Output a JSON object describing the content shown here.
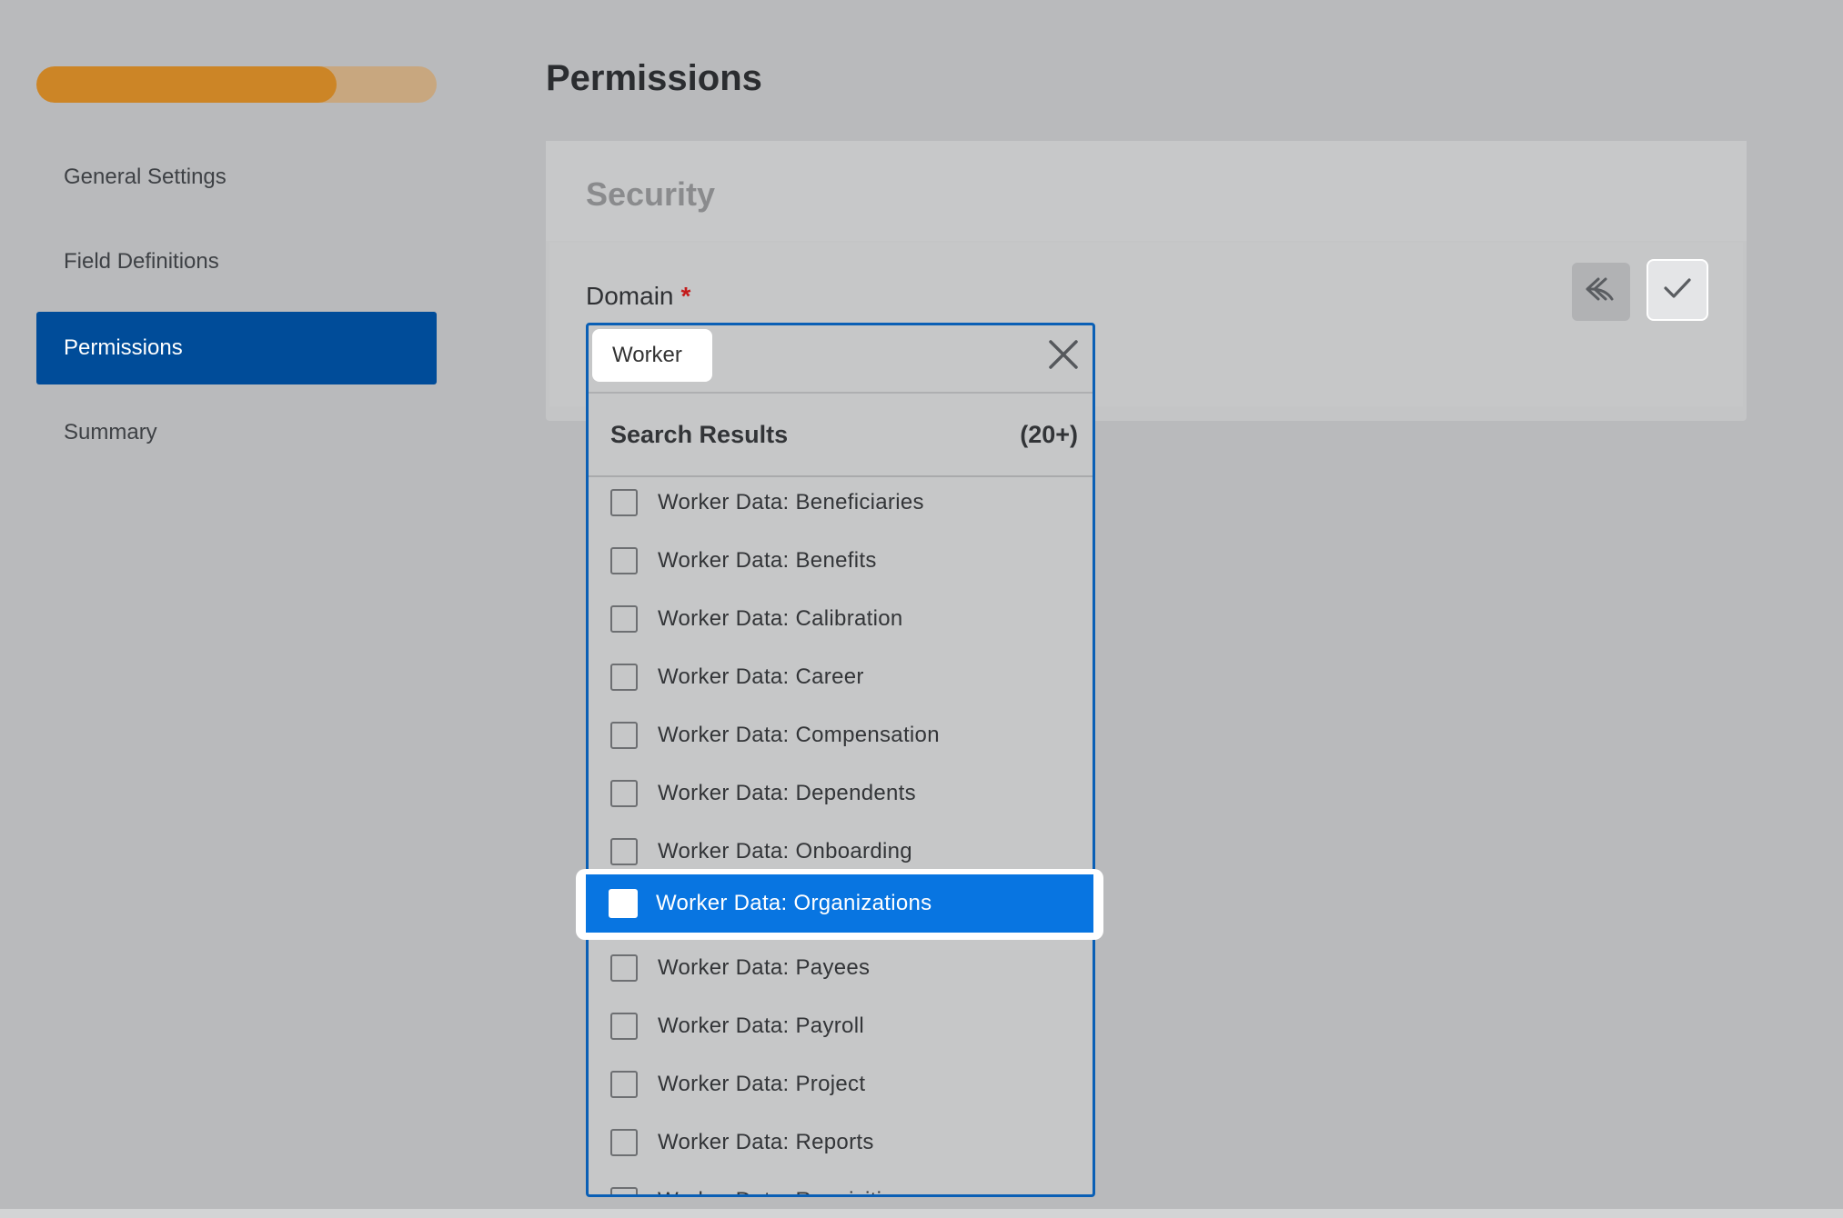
{
  "progress": {
    "value": 0.75
  },
  "sidebar": {
    "items": [
      {
        "label": "General Settings",
        "active": false
      },
      {
        "label": "Field Definitions",
        "active": false
      },
      {
        "label": "Permissions",
        "active": true
      },
      {
        "label": "Summary",
        "active": false
      }
    ]
  },
  "page": {
    "title": "Permissions"
  },
  "card": {
    "section_title": "Security",
    "field_label": "Domain",
    "required_mark": "*",
    "icons": {
      "undo": "undo-arrow-icon",
      "save": "checkmark-icon"
    }
  },
  "dropdown": {
    "search_value": "Worker",
    "clear_icon": "close-x-icon",
    "results_title": "Search Results",
    "results_count": "(20+)",
    "items": [
      "Worker Data: Beneficiaries",
      "Worker Data: Benefits",
      "Worker Data: Calibration",
      "Worker Data: Career",
      "Worker Data: Compensation",
      "Worker Data: Dependents",
      "Worker Data: Onboarding",
      "Worker Data: Organizations",
      "Worker Data: Payees",
      "Worker Data: Payroll",
      "Worker Data: Project",
      "Worker Data: Reports",
      "Worker Data: Requisitions"
    ],
    "highlighted_index": 7
  },
  "colors": {
    "progress_fill": "#cc8526",
    "progress_track": "#c8a77f",
    "nav_active": "#004c99",
    "dropdown_border": "#0a5fb5",
    "highlight": "#0875e1",
    "required": "#c41b1b"
  }
}
